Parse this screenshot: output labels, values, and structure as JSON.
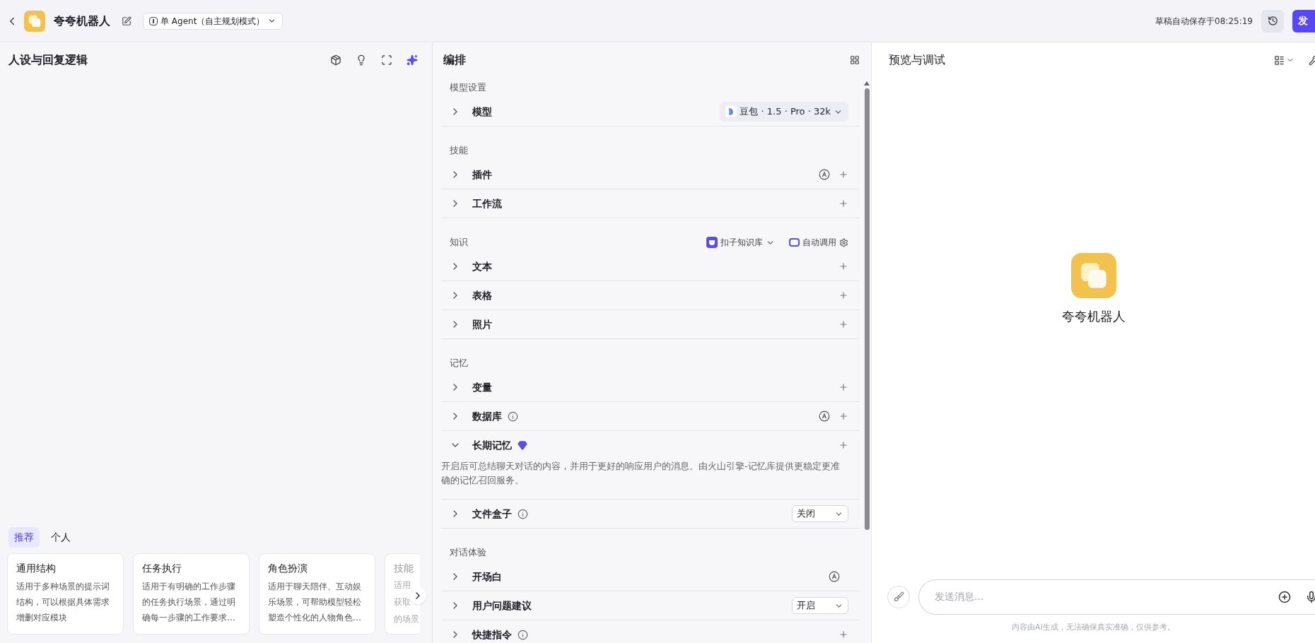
{
  "topbar": {
    "title": "夸夸机器人",
    "mode": "单 Agent（自主规划模式）",
    "autosave": "草稿自动保存于08:25:19",
    "publish": "发"
  },
  "persona": {
    "title": "人设与回复逻辑",
    "tabs": [
      {
        "label": "推荐",
        "selected": true
      },
      {
        "label": "个人",
        "selected": false
      }
    ],
    "templates": [
      {
        "kind": "full",
        "title": "通用结构",
        "description": "适用于多种场景的提示词结构，可以根据具体需求增删对应模块"
      },
      {
        "kind": "full",
        "title": "任务执行",
        "description": "适用于有明确的工作步骤的任务执行场景，通过明确每一步骤的工作要求…"
      },
      {
        "kind": "full",
        "title": "角色扮演",
        "description": "适用于聊天陪伴、互动娱乐场景，可帮助模型轻松塑造个性化的人物角色…"
      },
      {
        "kind": "partial",
        "title": "技能",
        "lines": [
          "适用",
          "获取",
          "的场景"
        ]
      }
    ]
  },
  "arrange": {
    "title": "编排",
    "sections": [
      {
        "title": "模型设置",
        "rows": [
          {
            "label": "模型",
            "expanded": false,
            "model": "豆包 · 1.5 · Pro · 32k"
          }
        ]
      },
      {
        "title": "技能",
        "rows": [
          {
            "label": "插件",
            "expanded": false,
            "auto": true,
            "add": true
          },
          {
            "label": "工作流",
            "expanded": false,
            "add": true
          }
        ]
      },
      {
        "title": "知识",
        "source": "扣子知识库",
        "mode": "自动调用",
        "rows": [
          {
            "label": "文本",
            "expanded": false,
            "add": true
          },
          {
            "label": "表格",
            "expanded": false,
            "add": true
          },
          {
            "label": "照片",
            "expanded": false,
            "add": true
          }
        ]
      },
      {
        "title": "记忆",
        "rows": [
          {
            "label": "变量",
            "expanded": false,
            "add": true
          },
          {
            "label": "数据库",
            "expanded": false,
            "info": true,
            "auto": true,
            "add": true
          },
          {
            "label": "长期记忆",
            "expanded": true,
            "premium": true,
            "add": true,
            "description": "开启后可总结聊天对话的内容，并用于更好的响应用户的消息。由火山引擎-记忆库提供更稳定更准确的记忆召回服务。"
          },
          {
            "label": "文件盒子",
            "expanded": false,
            "info": true,
            "select": "关闭"
          }
        ]
      },
      {
        "title": "对话体验",
        "rows": [
          {
            "label": "开场白",
            "expanded": false,
            "auto": true
          },
          {
            "label": "用户问题建议",
            "expanded": false,
            "select": "开启"
          },
          {
            "label": "快捷指令",
            "expanded": false,
            "info": true,
            "add": true
          }
        ]
      }
    ]
  },
  "preview": {
    "title": "预览与调试",
    "bot_name": "夸夸机器人",
    "input": {
      "placeholder": "发送消息..."
    },
    "disclaimer": "内容由AI生成，无法确保真实准确，仅供参考。"
  }
}
